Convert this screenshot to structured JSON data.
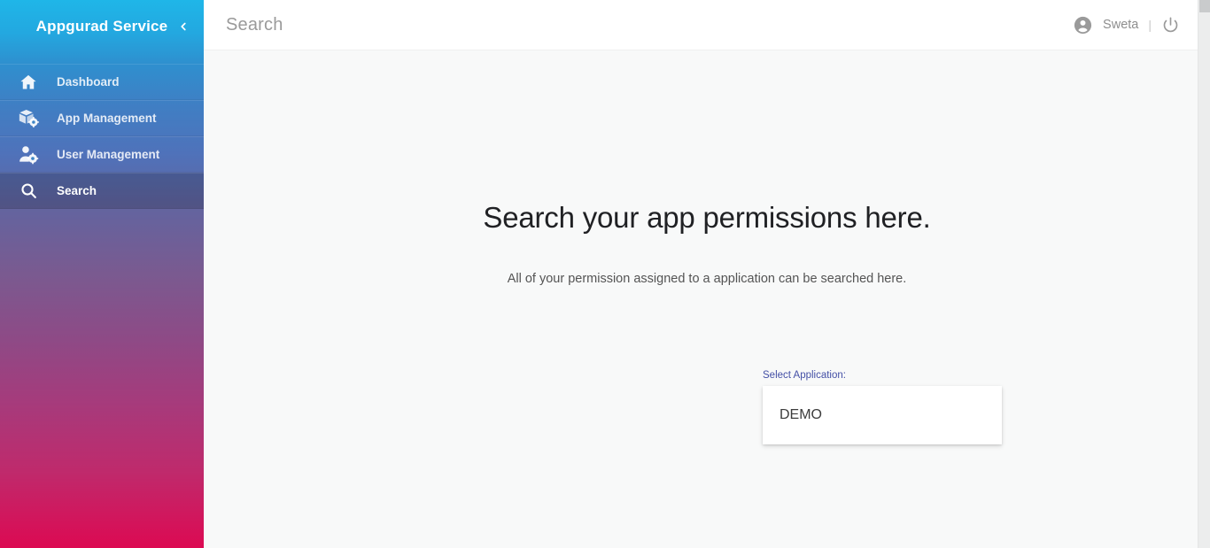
{
  "sidebar": {
    "brand_title": "Appgurad Service",
    "collapse_icon": "chevron-left-icon",
    "items": [
      {
        "label": "Dashboard",
        "icon": "home-icon",
        "active": false
      },
      {
        "label": "App Management",
        "icon": "box-gear-icon",
        "active": false
      },
      {
        "label": "User Management",
        "icon": "user-gear-icon",
        "active": false
      },
      {
        "label": "Search",
        "icon": "magnifier-icon",
        "active": true
      }
    ],
    "gradient_top": "#1fb6e8",
    "gradient_bottom": "#dc0a52"
  },
  "topbar": {
    "title": "Search",
    "account_icon": "account-circle-icon",
    "user_name": "Sweta",
    "separator": "|",
    "power_icon": "power-icon"
  },
  "main": {
    "heading": "Search your app permissions here.",
    "subtitle": "All of your permission assigned to a application can be searched here.",
    "select_label": "Select Application:",
    "select_options": [
      "DEMO"
    ],
    "select_label_color": "#4450a6"
  }
}
